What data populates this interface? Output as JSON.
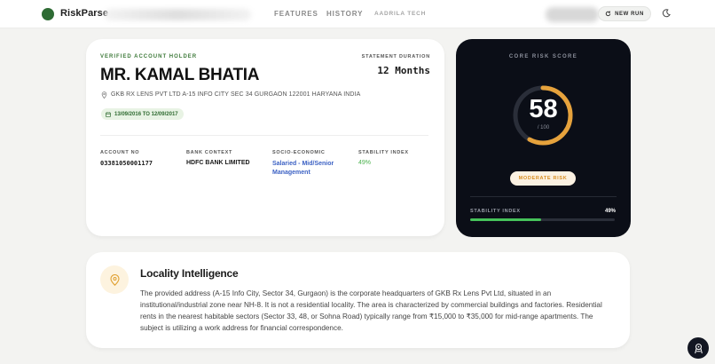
{
  "header": {
    "brand": "RiskParse",
    "nav": {
      "features": "FEATURES",
      "history": "HISTORY",
      "org": "AADRILA TECH"
    },
    "new_run": "NEW RUN"
  },
  "profile": {
    "verified_label": "VERIFIED ACCOUNT HOLDER",
    "name": "MR. KAMAL BHATIA",
    "address": "GKB RX LENS PVT LTD A-15 INFO CITY SEC 34 GURGAON 122001 HARYANA INDIA",
    "date_range": "13/09/2016 TO 12/09/2017",
    "statement_duration_label": "STATEMENT DURATION",
    "statement_duration": "12 Months",
    "fields": {
      "account_label": "ACCOUNT NO",
      "account_value": "03381050001177",
      "bank_label": "BANK CONTEXT",
      "bank_value": "HDFC BANK LIMITED",
      "socio_label": "SOCIO-ECONOMIC",
      "socio_value": "Salaried - Mid/Senior Management",
      "stability_label": "STABILITY INDEX",
      "stability_value": "49%"
    }
  },
  "score": {
    "label": "CORE RISK SCORE",
    "value": "58",
    "max": "/ 100",
    "gauge_fraction": 0.58,
    "risk_level": "MODERATE RISK",
    "stability_label": "STABILITY INDEX",
    "stability_value": "49%",
    "stability_fraction": 0.49,
    "colors": {
      "gauge": "#e6a23c",
      "track": "#2a2e39",
      "bar": "#46c25a",
      "card": "#0b0e17"
    }
  },
  "locality": {
    "title": "Locality Intelligence",
    "body": "The provided address (A-15 Info City, Sector 34, Gurgaon) is the corporate headquarters of GKB Rx Lens Pvt Ltd, situated in an institutional/industrial zone near NH-8. It is not a residential locality. The area is characterized by commercial buildings and factories. Residential rents in the nearest habitable sectors (Sector 33, 48, or Sohna Road) typically range from ₹15,000 to ₹35,000 for mid-range apartments. The subject is utilizing a work address for financial correspondence."
  },
  "icons": {
    "logo": "logo-dot",
    "new_run": "refresh-icon",
    "theme": "moon-icon",
    "address": "map-pin-icon",
    "date": "calendar-icon",
    "locality": "location-pin-icon",
    "assistant": "assistant-icon"
  }
}
